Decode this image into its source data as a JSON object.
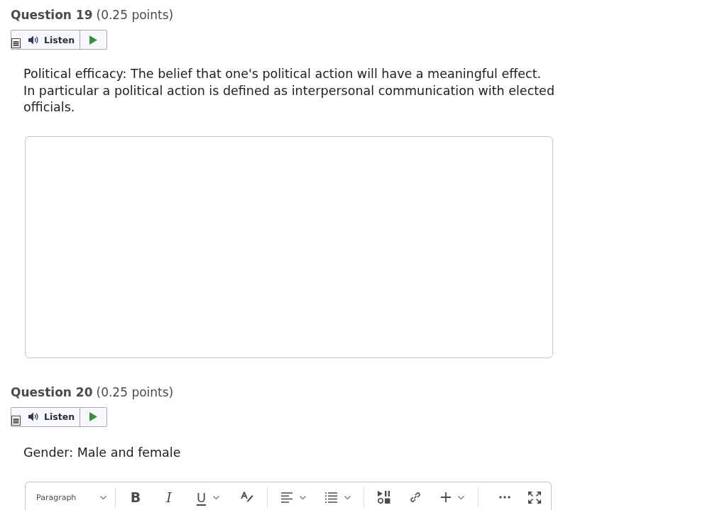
{
  "questions": [
    {
      "title": "Question 19",
      "points": "(0.25 points)",
      "listen": {
        "label": "Listen"
      },
      "prompt": [
        "Political efficacy: The belief that one's political action will have a meaningful effect.",
        "In particular a political action is defined as interpersonal communication with elected officials."
      ],
      "answer": {
        "kind": "plain"
      }
    },
    {
      "title": "Question 20",
      "points": "(0.25 points)",
      "listen": {
        "label": "Listen"
      },
      "prompt": [
        "Gender: Male and female"
      ],
      "answer": {
        "kind": "editor",
        "format": "Paragraph",
        "groups": [
          {
            "items": [
              {
                "kind": "bold",
                "label": "B",
                "dropdown": false
              },
              {
                "kind": "italic",
                "label": "I",
                "dropdown": false
              },
              {
                "kind": "underline",
                "label": "U",
                "dropdown": true
              },
              {
                "kind": "text-color",
                "dropdown": false
              }
            ]
          },
          {
            "items": [
              {
                "kind": "align",
                "dropdown": true
              },
              {
                "kind": "list",
                "dropdown": true
              }
            ]
          },
          {
            "items": [
              {
                "kind": "media",
                "dropdown": false
              },
              {
                "kind": "link",
                "dropdown": false
              },
              {
                "kind": "insert",
                "dropdown": true
              }
            ]
          },
          {
            "items": [
              {
                "kind": "more",
                "dropdown": false
              },
              {
                "kind": "fullscreen",
                "dropdown": false
              }
            ]
          }
        ]
      }
    }
  ]
}
